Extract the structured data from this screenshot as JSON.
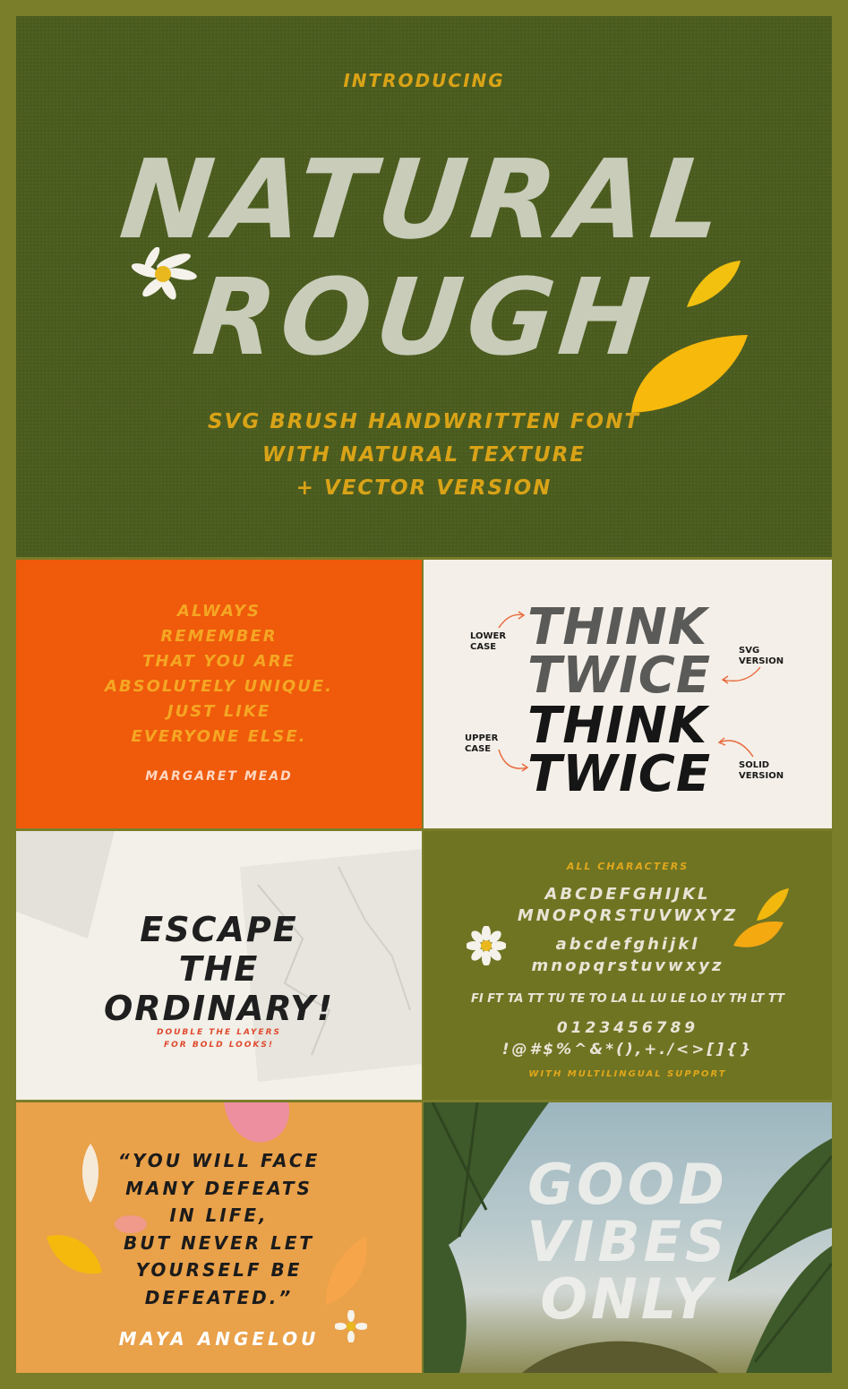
{
  "hero": {
    "intro": "INTRODUCING",
    "title_line1": "NATURAL",
    "title_line2": "ROUGH",
    "tagline_line1": "SVG BRUSH HANDWRITTEN FONT",
    "tagline_line2": "WITH NATURAL TEXTURE",
    "tagline_line3": "+ VECTOR VERSION"
  },
  "quote1": {
    "lines": [
      "ALWAYS",
      "REMEMBER",
      "THAT YOU ARE",
      "ABSOLUTELY UNIQUE.",
      "JUST LIKE",
      "EVERYONE ELSE."
    ],
    "author": "MARGARET MEAD"
  },
  "think": {
    "line1": "THINK",
    "line2": "TWICE",
    "line3": "THINK",
    "line4": "TWICE",
    "lower_case": [
      "LOWER",
      "CASE"
    ],
    "upper_case": [
      "UPPER",
      "CASE"
    ],
    "svg_version": [
      "SVG",
      "VERSION"
    ],
    "solid_version": [
      "SOLID",
      "VERSION"
    ]
  },
  "escape": {
    "lines": [
      "ESCAPE",
      "THE",
      "ORDINARY!"
    ],
    "sub_lines": [
      "DOUBLE THE LAYERS",
      "FOR BOLD LOOKS!"
    ]
  },
  "chars": {
    "header": "ALL CHARACTERS",
    "upper1": "ABCDEFGHIJKL",
    "upper2": "MNOPQRSTUVWXYZ",
    "lower1": "abcdefghijkl",
    "lower2": "mnopqrstuvwxyz",
    "ligatures": "FI FT TA TT TU TE TO LA LL LU LE LO LY TH LT TT",
    "numbers": "0123456789",
    "symbols": "!@#$%^&*(),+./<>[]{}",
    "footer": "WITH MULTILINGUAL SUPPORT"
  },
  "quote2": {
    "lines": [
      "“YOU WILL FACE",
      "MANY DEFEATS",
      "IN LIFE,",
      "BUT NEVER LET",
      "YOURSELF BE",
      "DEFEATED.”"
    ],
    "author": "MAYA ANGELOU"
  },
  "vibes": {
    "lines": [
      "GOOD",
      "VIBES",
      "ONLY"
    ]
  },
  "colors": {
    "frame": "#7a7d2a",
    "hero_bg": "#4a5b1e",
    "accent_gold": "#d9a317",
    "orange": "#ef5a0b",
    "cream": "#f4efe8"
  }
}
